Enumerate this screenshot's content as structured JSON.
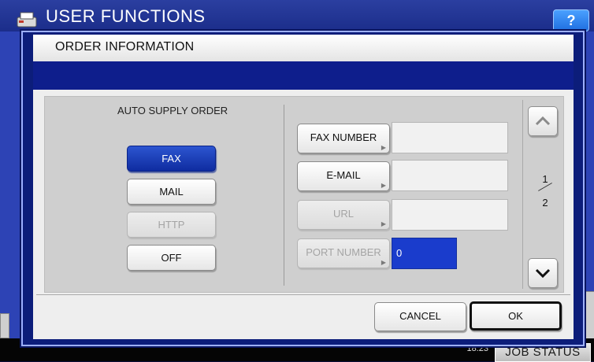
{
  "app": {
    "title": "USER FUNCTIONS",
    "help_label": "?",
    "datetime": "18:23",
    "job_status_label": "JOB STATUS"
  },
  "dialog": {
    "title": "ORDER INFORMATION",
    "auto_supply_label": "AUTO SUPPLY ORDER",
    "methods": [
      {
        "label": "FAX",
        "state": "selected"
      },
      {
        "label": "MAIL",
        "state": "enabled"
      },
      {
        "label": "HTTP",
        "state": "disabled"
      },
      {
        "label": "OFF",
        "state": "enabled"
      }
    ],
    "fields": [
      {
        "label": "FAX NUMBER",
        "value": "",
        "state": "enabled"
      },
      {
        "label": "E-MAIL",
        "value": "",
        "state": "enabled"
      },
      {
        "label": "URL",
        "value": "",
        "state": "disabled"
      },
      {
        "label": "PORT NUMBER",
        "value": "0",
        "state": "disabled"
      }
    ],
    "page": {
      "current": "1",
      "total": "2"
    },
    "cancel_label": "CANCEL",
    "ok_label": "OK"
  },
  "colors": {
    "accent": "#1a3ccc",
    "header_bg": "#1b2d8a",
    "footer_bg": "#050505"
  }
}
